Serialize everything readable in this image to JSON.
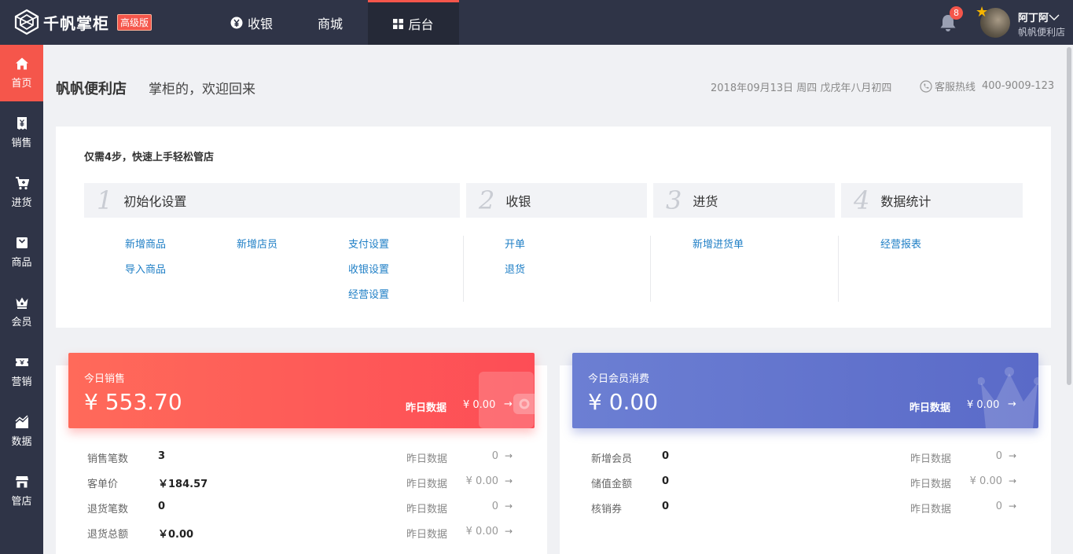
{
  "app": {
    "logo_text": "千帆掌柜",
    "edition_badge": "高级版"
  },
  "nav": {
    "tabs": [
      {
        "label": "收银"
      },
      {
        "label": "商城"
      },
      {
        "label": "后台"
      }
    ],
    "active_tab": "后台"
  },
  "notifications": {
    "count": "8"
  },
  "user": {
    "name": "阿丁阿",
    "store": "帆帆便利店"
  },
  "sidebar": {
    "items": [
      {
        "label": "首页"
      },
      {
        "label": "销售"
      },
      {
        "label": "进货"
      },
      {
        "label": "商品"
      },
      {
        "label": "会员"
      },
      {
        "label": "营销"
      },
      {
        "label": "数据"
      },
      {
        "label": "管店"
      }
    ],
    "active": "首页"
  },
  "header": {
    "store_name": "帆帆便利店",
    "welcome": "掌柜的，欢迎回来",
    "date": "2018年09月13日  周四  戊戌年八月初四",
    "hotline_label": "客服热线",
    "hotline_number": "400-9009-123"
  },
  "steps": {
    "title": "仅需4步，快速上手轻松管店",
    "items": [
      {
        "num": "1",
        "label": "初始化设置",
        "links": [
          "新增商品",
          "导入商品",
          "新增店员",
          "支付设置",
          "收银设置",
          "经营设置"
        ]
      },
      {
        "num": "2",
        "label": "收银",
        "links": [
          "开单",
          "退货"
        ]
      },
      {
        "num": "3",
        "label": "进货",
        "links": [
          "新增进货单"
        ]
      },
      {
        "num": "4",
        "label": "数据统计",
        "links": [
          "经营报表"
        ]
      }
    ]
  },
  "sales": {
    "banner_label": "今日销售",
    "banner_value": "¥  553.70",
    "yesterday_label": "昨日数据",
    "yesterday_value": "¥ 0.00",
    "rows": [
      {
        "label": "销售笔数",
        "value": "3",
        "yest_label": "昨日数据",
        "yest_value": "0"
      },
      {
        "label": "客单价",
        "value": "￥184.57",
        "yest_label": "昨日数据",
        "yest_value": "¥ 0.00"
      },
      {
        "label": "退货笔数",
        "value": "0",
        "yest_label": "昨日数据",
        "yest_value": "0"
      },
      {
        "label": "退货总额",
        "value": "￥0.00",
        "yest_label": "昨日数据",
        "yest_value": "¥ 0.00"
      }
    ]
  },
  "members": {
    "banner_label": "今日会员消费",
    "banner_value": "¥  0.00",
    "yesterday_label": "昨日数据",
    "yesterday_value": "¥ 0.00",
    "rows": [
      {
        "label": "新增会员",
        "value": "0",
        "yest_label": "昨日数据",
        "yest_value": "0"
      },
      {
        "label": "储值金额",
        "value": "0",
        "yest_label": "昨日数据",
        "yest_value": "¥ 0.00"
      },
      {
        "label": "核销券",
        "value": "0",
        "yest_label": "昨日数据",
        "yest_value": "0"
      }
    ]
  },
  "colors": {
    "topbar": "#2f3447",
    "accent_red": "#f5564b",
    "link_blue": "#1f7fc6",
    "member_blue": "#5a6ac8"
  }
}
